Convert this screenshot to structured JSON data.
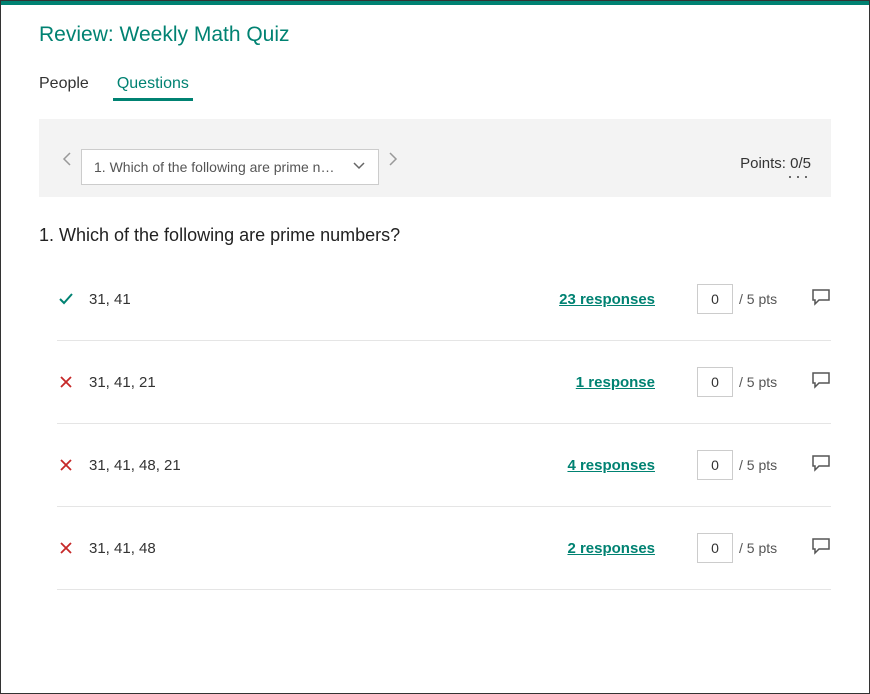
{
  "header": {
    "title": "Review: Weekly Math Quiz"
  },
  "tabs": {
    "people": "People",
    "questions": "Questions",
    "active_index": 1
  },
  "question_nav": {
    "dropdown_text": "1. Which of the following are prime num…",
    "points_label": "Points: 0/5"
  },
  "question": {
    "title": "1. Which of the following are prime numbers?",
    "max_points": 5,
    "answers": [
      {
        "correct": true,
        "text": "31, 41",
        "responses_label": "23 responses",
        "points_value": "0",
        "suffix": "/ 5 pts"
      },
      {
        "correct": false,
        "text": "31, 41, 21",
        "responses_label": "1 response",
        "points_value": "0",
        "suffix": "/ 5 pts"
      },
      {
        "correct": false,
        "text": "31, 41, 48, 21",
        "responses_label": "4 responses",
        "points_value": "0",
        "suffix": "/ 5 pts"
      },
      {
        "correct": false,
        "text": "31, 41, 48",
        "responses_label": "2 responses",
        "points_value": "0",
        "suffix": "/ 5 pts"
      }
    ]
  },
  "colors": {
    "accent": "#008272",
    "correct": "#008272",
    "incorrect": "#c62828"
  }
}
